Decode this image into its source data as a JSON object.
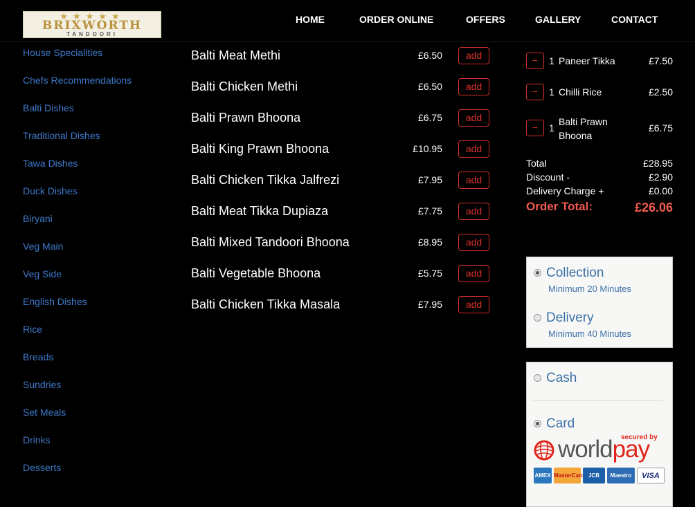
{
  "header": {
    "logo_stars": "★★★★★",
    "logo_main": "BRIXWORTH",
    "logo_sub": "TANDOORI",
    "nav": [
      "HOME",
      "ORDER ONLINE",
      "OFFERS",
      "GALLERY",
      "CONTACT"
    ]
  },
  "sidebar": [
    "House Specialities",
    "Chefs Recommendations",
    "Balti Dishes",
    "Traditional Dishes",
    "Tawa Dishes",
    "Duck Dishes",
    "Biryani",
    "Veg Main",
    "Veg Side",
    "English Dishes",
    "Rice",
    "Breads",
    "Sundries",
    "Set Meals",
    "Drinks",
    "Desserts"
  ],
  "menu": {
    "add_label": "add",
    "items": [
      {
        "name": "Balti Meat Methi",
        "price": "£6.50"
      },
      {
        "name": "Balti Chicken Methi",
        "price": "£6.50"
      },
      {
        "name": "Balti Prawn Bhoona",
        "price": "£6.75"
      },
      {
        "name": "Balti King Prawn Bhoona",
        "price": "£10.95"
      },
      {
        "name": "Balti Chicken Tikka Jalfrezi",
        "price": "£7.95"
      },
      {
        "name": "Balti Meat Tikka Dupiaza",
        "price": "£7.75"
      },
      {
        "name": "Balti Mixed Tandoori Bhoona",
        "price": "£8.95"
      },
      {
        "name": "Balti Vegetable Bhoona",
        "price": "£5.75"
      },
      {
        "name": "Balti Chicken Tikka Masala",
        "price": "£7.95"
      }
    ]
  },
  "basket": {
    "minus_label": "–",
    "items": [
      {
        "qty": "1",
        "name": "Paneer Tikka",
        "price": "£7.50"
      },
      {
        "qty": "1",
        "name": "Chilli Rice",
        "price": "£2.50"
      },
      {
        "qty": "1",
        "name": "Balti Prawn Bhoona",
        "price": "£6.75"
      }
    ],
    "total_label": "Total",
    "total_value": "£28.95",
    "discount_label": "Discount -",
    "discount_value": "£2.90",
    "delivery_label": "Delivery Charge +",
    "delivery_value": "£0.00",
    "order_total_label": "Order Total:",
    "order_total_value": "£26.06"
  },
  "order_type": {
    "selected": "Collection",
    "options": [
      {
        "label": "Collection",
        "sub": "Minimum 20 Minutes"
      },
      {
        "label": "Delivery",
        "sub": "Minimum 40 Minutes"
      }
    ]
  },
  "payment": {
    "selected": "Card",
    "options": [
      "Cash",
      "Card"
    ],
    "worldpay_secured": "secured by",
    "worldpay_world": "world",
    "worldpay_pay": "pay",
    "cards": [
      "AMEX",
      "MasterCard",
      "JCB",
      "Maestro",
      "VISA"
    ]
  },
  "colors": {
    "accent_red": "#d9302b",
    "total_red": "#f15a4f",
    "link_blue": "#3e79c9",
    "option_blue": "#3c70a8"
  }
}
